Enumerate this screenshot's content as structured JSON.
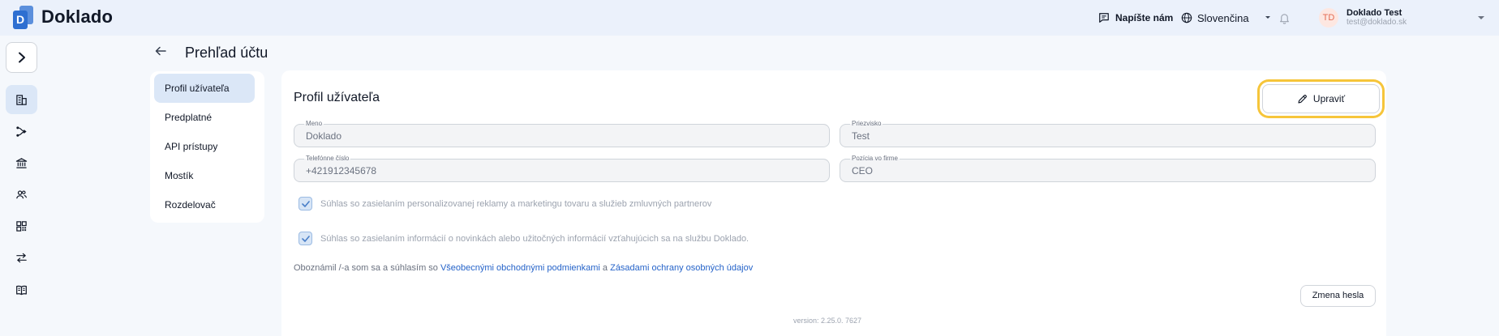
{
  "app": {
    "name": "Doklado",
    "logo_letter": "D"
  },
  "topbar": {
    "write_us": "Napíšte nám",
    "language": "Slovenčina",
    "user": {
      "initials": "TD",
      "name": "Doklado Test",
      "email": "test@doklado.sk"
    }
  },
  "sidebar": {
    "icons": [
      "chevron-right-icon",
      "buildings-icon",
      "flow-icon",
      "bank-icon",
      "users-icon",
      "qr-code-icon",
      "transfer-icon",
      "book-icon"
    ],
    "active": "buildings-icon"
  },
  "page": {
    "title": "Prehľad účtu"
  },
  "menu": {
    "items": [
      {
        "label": "Profil užívateľa",
        "active": true
      },
      {
        "label": "Predplatné",
        "active": false
      },
      {
        "label": "API prístupy",
        "active": false
      },
      {
        "label": "Mostík",
        "active": false
      },
      {
        "label": "Rozdelovač",
        "active": false
      }
    ]
  },
  "profile": {
    "title": "Profil užívateľa",
    "edit_label": "Upraviť",
    "fields": {
      "first_name": {
        "label": "Meno",
        "value": "Doklado"
      },
      "last_name": {
        "label": "Priezvisko",
        "value": "Test"
      },
      "phone": {
        "label": "Telefónne číslo",
        "value": "+421912345678"
      },
      "position": {
        "label": "Pozícia vo firme",
        "value": "CEO"
      }
    },
    "consents": [
      {
        "label": "Súhlas so zasielaním personalizovanej reklamy a marketingu tovaru a služieb zmluvných partnerov",
        "checked": true
      },
      {
        "label": "Súhlas so zasielaním informácií o novinkách alebo užitočných informácií vzťahujúcich sa na službu Doklado.",
        "checked": true
      }
    ],
    "terms": {
      "prefix": "Oboznámil /-a som sa a súhlasím so ",
      "link1": "Všeobecnými obchodnými podmienkami",
      "middle": " a ",
      "link2": "Zásadami ochrany osobných údajov"
    },
    "change_password_label": "Zmena hesla"
  },
  "footer": {
    "version": "version: 2.25.0. 7627"
  },
  "colors": {
    "accent": "#2563c9",
    "highlight_ring": "#f6c53a",
    "active_bg": "#dbe7f7"
  }
}
